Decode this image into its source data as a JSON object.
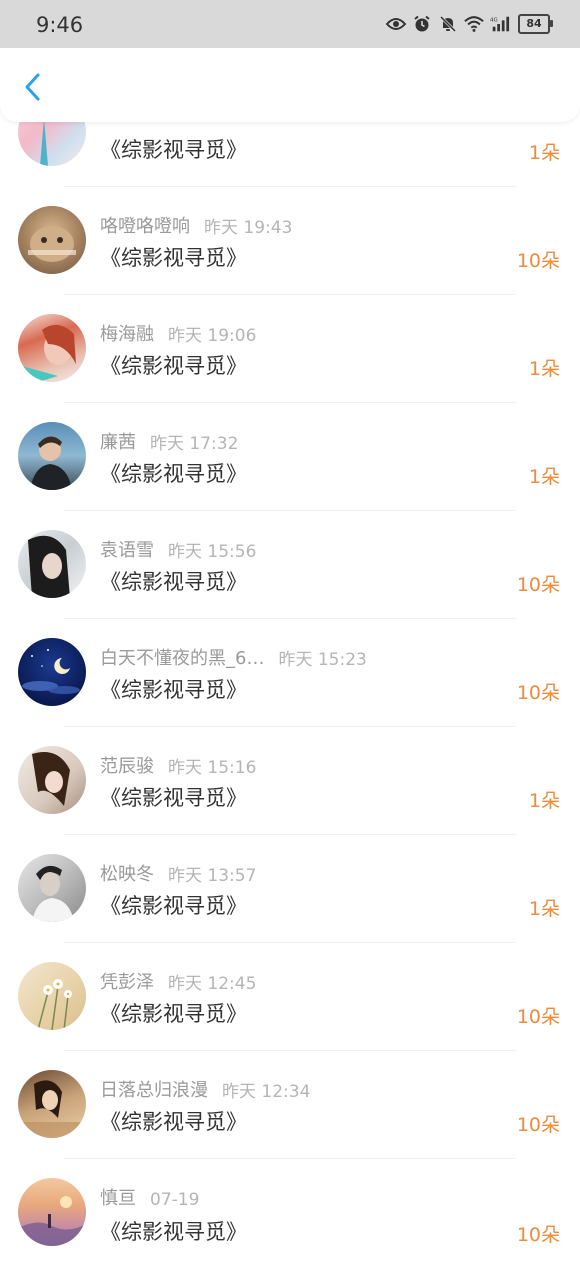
{
  "status_bar": {
    "time": "9:46",
    "battery": "84",
    "icons": [
      "eye-icon",
      "alarm-icon",
      "mute-bell-icon",
      "wifi-icon",
      "signal-icon"
    ]
  },
  "header": {
    "back_icon": "chevron-left-icon"
  },
  "colors": {
    "accent": "#2d9ef0",
    "amount": "#f08a3c"
  },
  "items": [
    {
      "name": "",
      "time": "",
      "title": "《综影视寻觅》",
      "amount": "1朵"
    },
    {
      "name": "咯噔咯噔响",
      "time": "昨天 19:43",
      "title": "《综影视寻觅》",
      "amount": "10朵"
    },
    {
      "name": "梅海融",
      "time": "昨天 19:06",
      "title": "《综影视寻觅》",
      "amount": "1朵"
    },
    {
      "name": "廉茜",
      "time": "昨天 17:32",
      "title": "《综影视寻觅》",
      "amount": "1朵"
    },
    {
      "name": "袁语雪",
      "time": "昨天 15:56",
      "title": "《综影视寻觅》",
      "amount": "10朵"
    },
    {
      "name": "白天不懂夜的黑_6…",
      "time": "昨天 15:23",
      "title": "《综影视寻觅》",
      "amount": "10朵"
    },
    {
      "name": "范辰骏",
      "time": "昨天 15:16",
      "title": "《综影视寻觅》",
      "amount": "1朵"
    },
    {
      "name": "松映冬",
      "time": "昨天 13:57",
      "title": "《综影视寻觅》",
      "amount": "1朵"
    },
    {
      "name": "凭彭泽",
      "time": "昨天 12:45",
      "title": "《综影视寻觅》",
      "amount": "10朵"
    },
    {
      "name": "日落总归浪漫",
      "time": "昨天 12:34",
      "title": "《综影视寻觅》",
      "amount": "10朵"
    },
    {
      "name": "慎亘",
      "time": "07-19",
      "title": "《综影视寻觅》",
      "amount": "10朵"
    }
  ]
}
